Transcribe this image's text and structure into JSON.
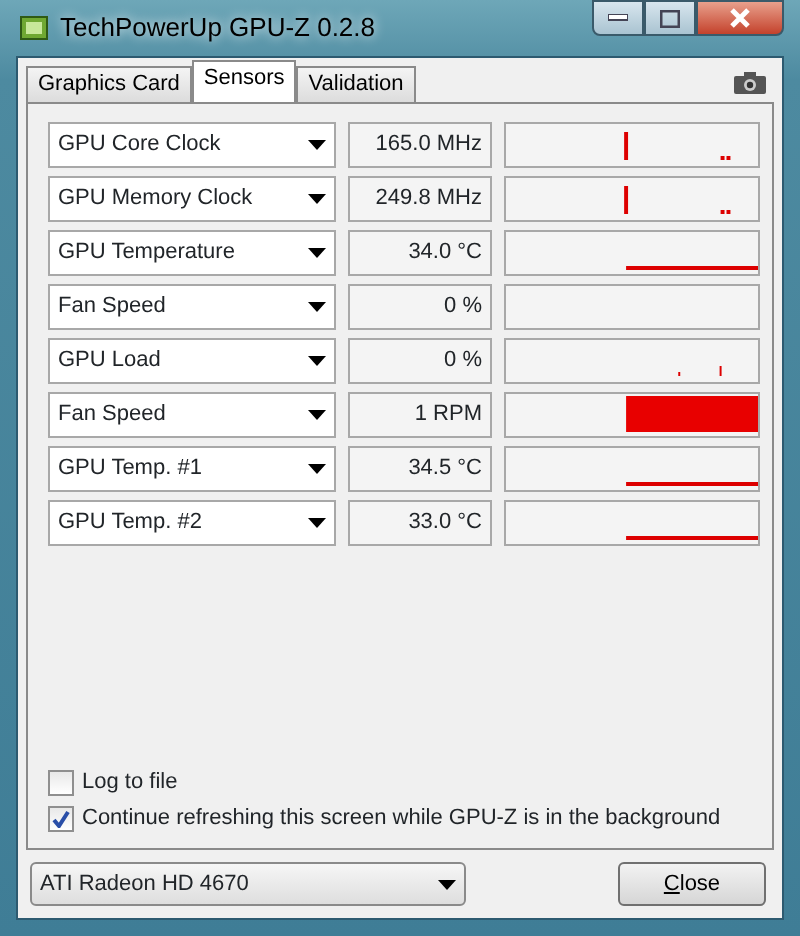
{
  "window": {
    "title": "TechPowerUp GPU-Z 0.2.8"
  },
  "tabs": [
    {
      "label": "Graphics Card",
      "selected": false
    },
    {
      "label": "Sensors",
      "selected": true
    },
    {
      "label": "Validation",
      "selected": false
    }
  ],
  "sensors": [
    {
      "name": "GPU Core Clock",
      "reading": "165.0 MHz",
      "kind": "spike"
    },
    {
      "name": "GPU Memory Clock",
      "reading": "249.8 MHz",
      "kind": "spike"
    },
    {
      "name": "GPU Temperature",
      "reading": "34.0 °C",
      "kind": "line"
    },
    {
      "name": "Fan Speed",
      "reading": "0 %",
      "kind": "empty"
    },
    {
      "name": "GPU Load",
      "reading": "0 %",
      "kind": "ticks"
    },
    {
      "name": "Fan Speed",
      "reading": "1 RPM",
      "kind": "block"
    },
    {
      "name": "GPU Temp. #1",
      "reading": "34.5 °C",
      "kind": "line"
    },
    {
      "name": "GPU Temp. #2",
      "reading": "33.0 °C",
      "kind": "line"
    }
  ],
  "options": [
    {
      "label": "Log to file",
      "checked": false
    },
    {
      "label": "Continue refreshing this screen while GPU-Z is in the background",
      "checked": true
    }
  ],
  "card_select": {
    "value": "ATI Radeon HD 4670"
  },
  "close_button": {
    "label": "Close"
  }
}
